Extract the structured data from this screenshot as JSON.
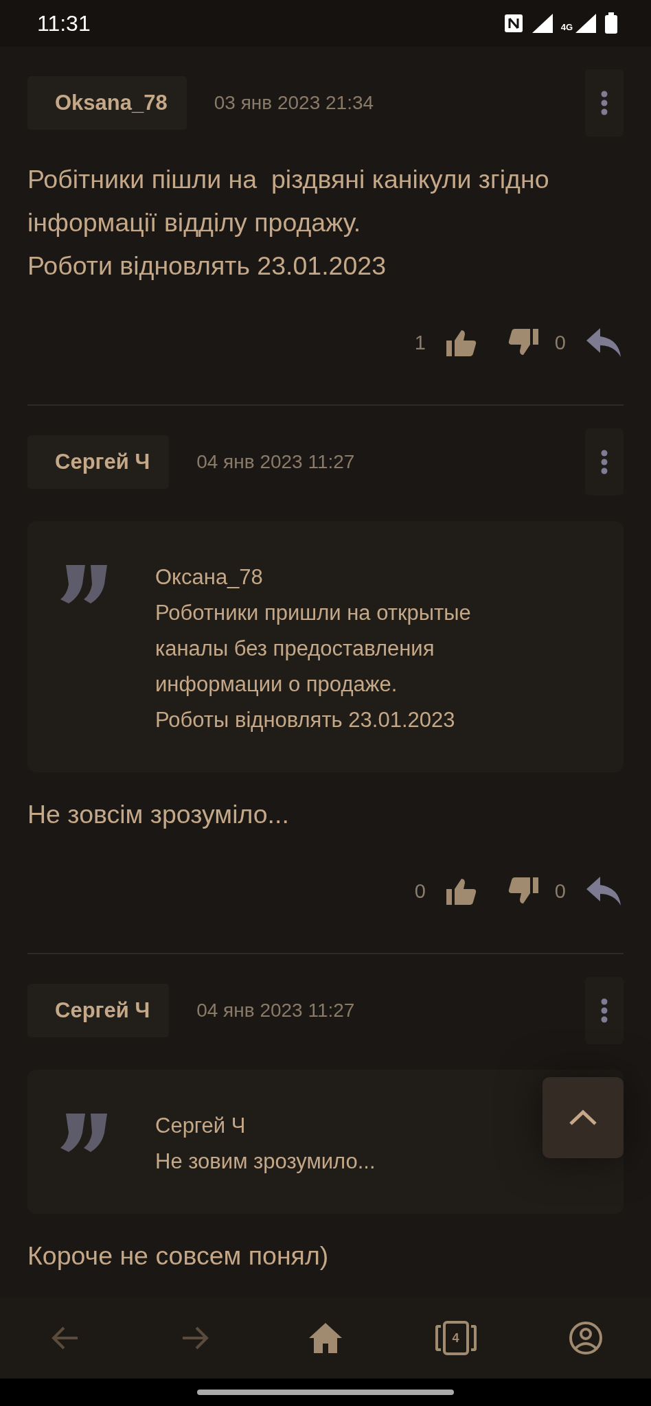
{
  "status_bar": {
    "time": "11:31",
    "network": "4G"
  },
  "comments": [
    {
      "author": "Oksana_78",
      "date": "03 янв 2023 21:34",
      "body": [
        "Робітники пішли на  різдвяні канікули згідно інформації відділу продажу.",
        "Роботи відновлять 23.01.2023"
      ],
      "likes": "1",
      "dislikes": "0"
    },
    {
      "author": "Сергей Ч",
      "date": "04 янв 2023 11:27",
      "quote": {
        "author": "Оксана_78",
        "text": [
          "Роботники пришли на открытые каналы без предоставления информации о продаже.",
          "Роботы відновлять 23.01.2023"
        ]
      },
      "body": [
        "Не зовсім зрозуміло..."
      ],
      "likes": "0",
      "dislikes": "0"
    },
    {
      "author": "Сергей Ч",
      "date": "04 янв 2023 11:27",
      "quote": {
        "author": "Сергей Ч",
        "text": [
          "Не зовим зрозумило..."
        ]
      },
      "body": [
        "Короче не совсем понял)"
      ]
    }
  ],
  "nav": [
    {
      "kind": "back",
      "disabled": true
    },
    {
      "kind": "forward",
      "disabled": true
    },
    {
      "kind": "home",
      "disabled": false
    },
    {
      "kind": "tabs",
      "count": "4",
      "disabled": false
    },
    {
      "kind": "profile",
      "disabled": false
    }
  ]
}
